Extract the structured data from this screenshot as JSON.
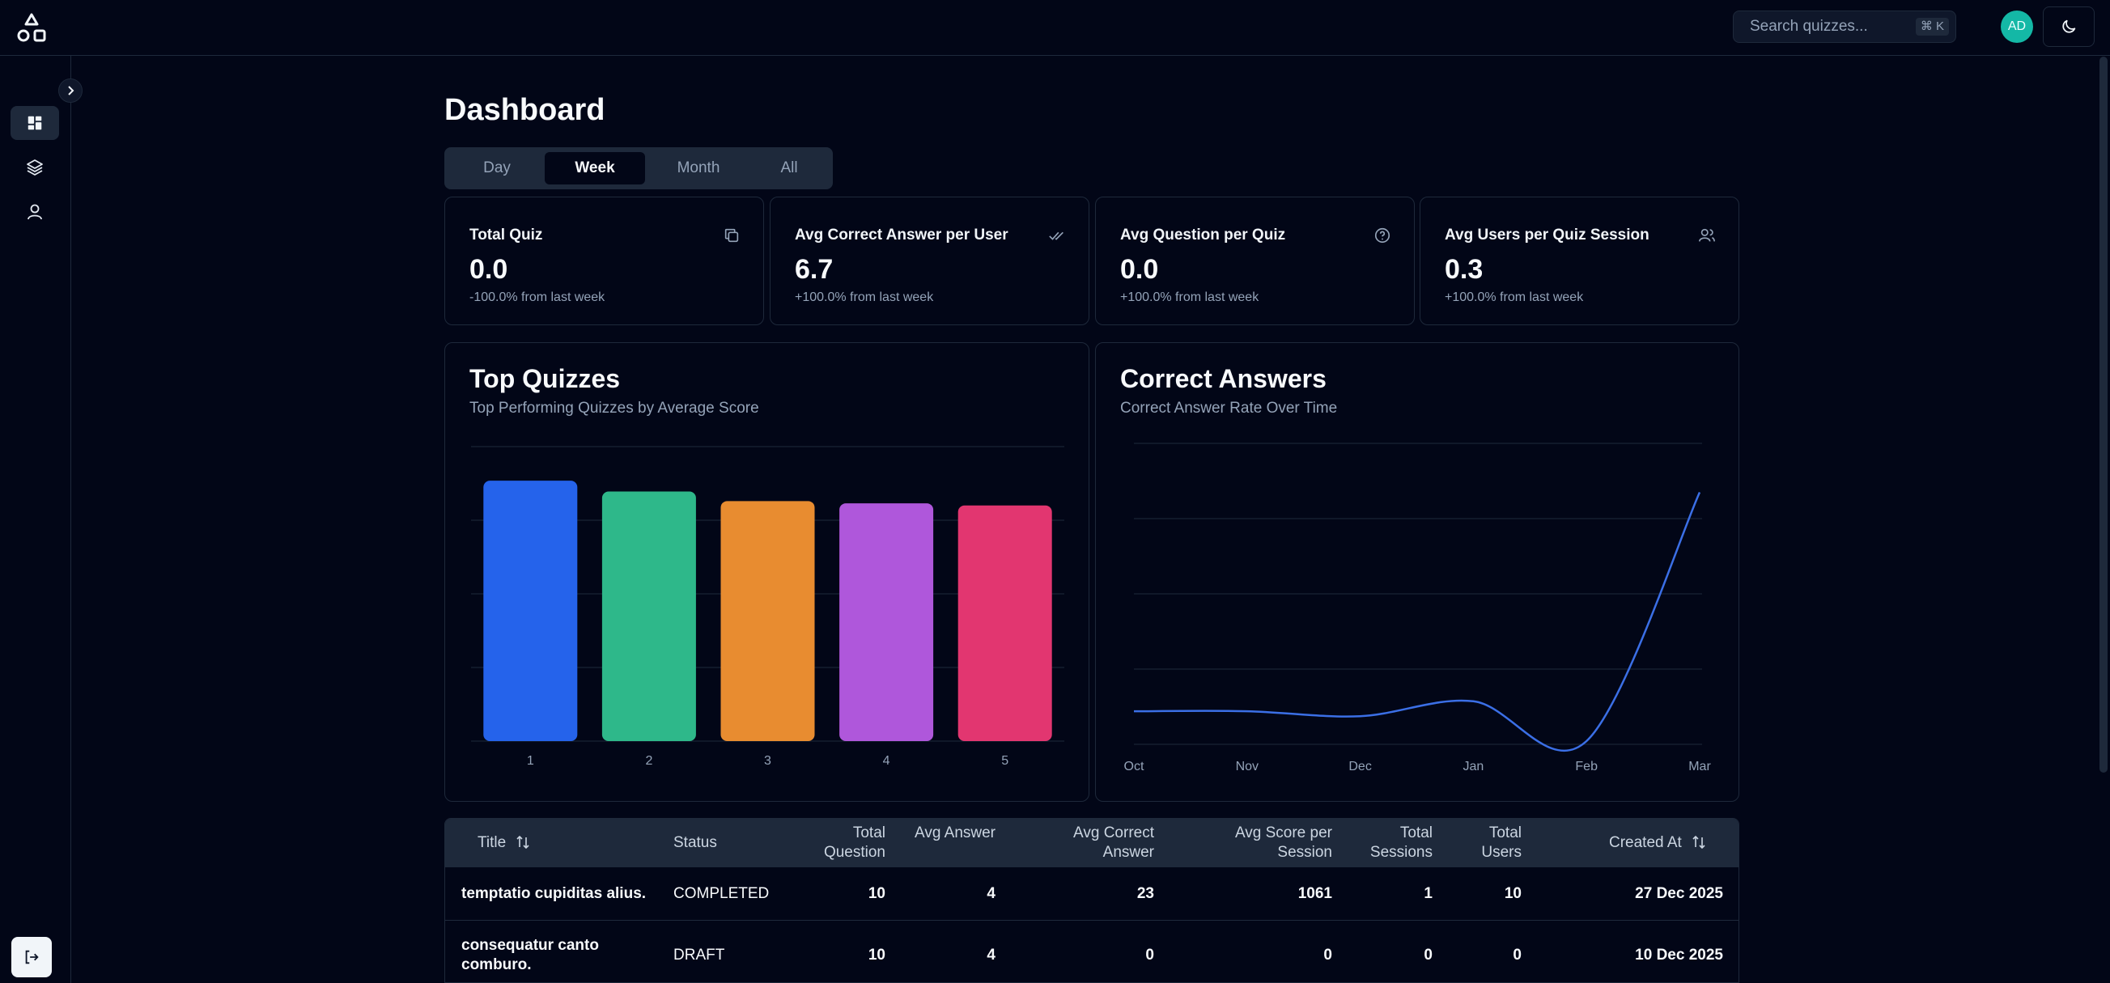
{
  "header": {
    "search_placeholder": "Search quizzes...",
    "search_shortcut": "⌘ K",
    "avatar_initials": "AD"
  },
  "sidebar": {
    "items": [
      {
        "icon": "dashboard-icon",
        "active": true
      },
      {
        "icon": "layers-icon",
        "active": false
      },
      {
        "icon": "user-icon",
        "active": false
      }
    ]
  },
  "page": {
    "title": "Dashboard",
    "tabs": [
      "Day",
      "Week",
      "Month",
      "All"
    ],
    "active_tab": "Week"
  },
  "stats": [
    {
      "title": "Total Quiz",
      "value": "0.0",
      "delta": "-100.0% from last week",
      "icon": "copy-icon"
    },
    {
      "title": "Avg Correct Answer per User",
      "value": "6.7",
      "delta": "+100.0% from last week",
      "icon": "check-double-icon"
    },
    {
      "title": "Avg Question per Quiz",
      "value": "0.0",
      "delta": "+100.0% from last week",
      "icon": "help-circle-icon"
    },
    {
      "title": "Avg Users per Quiz Session",
      "value": "0.3",
      "delta": "+100.0% from last week",
      "icon": "users-icon"
    }
  ],
  "top_quizzes": {
    "title": "Top Quizzes",
    "subtitle": "Top Performing Quizzes by Average Score"
  },
  "correct_answers": {
    "title": "Correct Answers",
    "subtitle": "Correct Answer Rate Over Time"
  },
  "chart_data": [
    {
      "type": "bar",
      "title": "Top Quizzes",
      "categories": [
        "1",
        "2",
        "3",
        "4",
        "5"
      ],
      "values": [
        1061,
        1017,
        978,
        969,
        960
      ],
      "ylim": [
        0,
        1200
      ],
      "colors": [
        "#2563eb",
        "#2eb88a",
        "#e88c30",
        "#af57db",
        "#e23670"
      ],
      "grid": true
    },
    {
      "type": "line",
      "title": "Correct Answers",
      "x": [
        "Oct",
        "Nov",
        "Dec",
        "Jan",
        "Feb",
        "Mar"
      ],
      "series": [
        {
          "values": [
            1,
            1,
            0.5,
            2,
            -2,
            23
          ]
        }
      ],
      "ylim": [
        -2,
        28
      ],
      "color": "#3b6fe6",
      "grid": true
    }
  ],
  "table": {
    "columns": [
      "Title",
      "Status",
      "Total Question",
      "Avg Answer",
      "Avg Correct Answer",
      "Avg Score per Session",
      "Total Sessions",
      "Total Users",
      "Created At"
    ],
    "rows": [
      [
        "temptatio cupiditas alius.",
        "COMPLETED",
        "10",
        "4",
        "23",
        "1061",
        "1",
        "10",
        "27 Dec 2025"
      ],
      [
        "consequatur canto comburo.",
        "DRAFT",
        "10",
        "4",
        "0",
        "0",
        "0",
        "0",
        "10 Dec 2025"
      ]
    ]
  }
}
